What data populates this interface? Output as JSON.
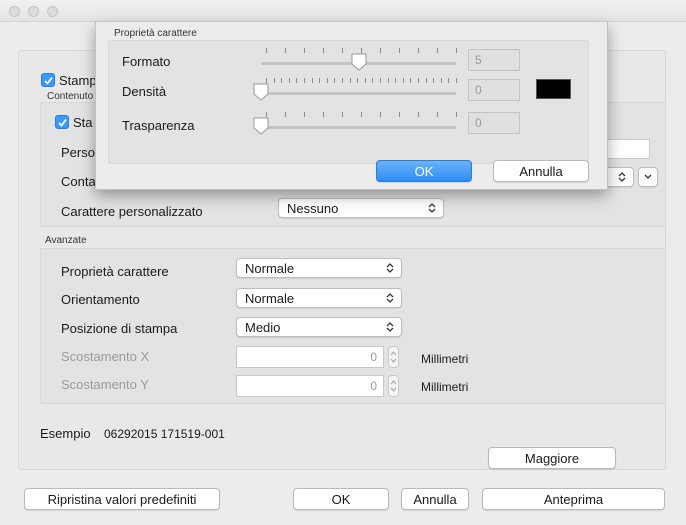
{
  "window": {
    "title": ""
  },
  "main": {
    "stamp_checkbox_label": "Stamp",
    "contents_group_label": "Contenuto",
    "inner_checkbox_label": "Sta",
    "row_person_label": "Perso",
    "row_count_label": "Conta",
    "custom_char_label": "Carattere personalizzato",
    "custom_char_value": "Nessuno",
    "advanced_group_label": "Avanzate",
    "char_props_label": "Proprietà carattere",
    "char_props_value": "Normale",
    "orientation_label": "Orientamento",
    "orientation_value": "Normale",
    "print_pos_label": "Posizione di stampa",
    "print_pos_value": "Medio",
    "offset_x_label": "Scostamento X",
    "offset_x_value": "0",
    "offset_x_unit": "Millimetri",
    "offset_y_label": "Scostamento Y",
    "offset_y_value": "0",
    "offset_y_unit": "Millimetri",
    "example_label": "Esempio",
    "example_value": "06292015 171519-001",
    "more_button": "Maggiore",
    "restore_button": "Ripristina valori predefiniti",
    "ok_button": "OK",
    "cancel_button": "Annulla",
    "preview_button": "Anteprima"
  },
  "sheet": {
    "group_title": "Proprietà carattere",
    "format_label": "Formato",
    "format_value": "5",
    "format_level": 0.5,
    "density_label": "Densità",
    "density_value": "0",
    "density_level": 0,
    "transparency_label": "Trasparenza",
    "transparency_value": "0",
    "transparency_level": 0,
    "color_swatch": "#000000",
    "ok_button": "OK",
    "cancel_button": "Annulla"
  },
  "colors": {
    "accent": "#3b99fc",
    "window_bg": "#ececec"
  }
}
